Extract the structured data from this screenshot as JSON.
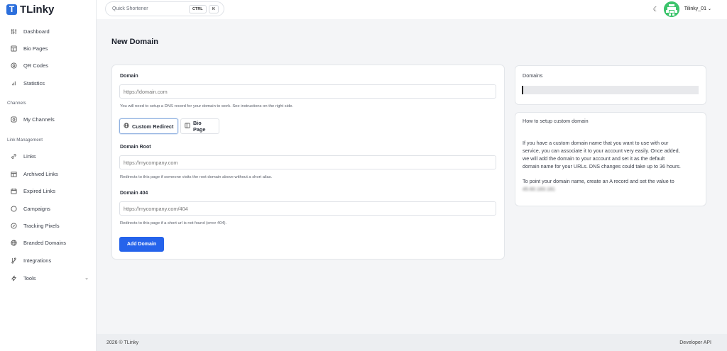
{
  "brand": {
    "name": "TLinky",
    "mark": "T"
  },
  "sidebar": {
    "items": [
      {
        "label": "Dashboard",
        "icon": "sliders-icon"
      },
      {
        "label": "Bio Pages",
        "icon": "layout-icon"
      },
      {
        "label": "QR Codes",
        "icon": "qr-icon"
      },
      {
        "label": "Statistics",
        "icon": "bar-chart-icon"
      }
    ],
    "channels_section": "Channels",
    "channels_items": [
      {
        "label": "My Channels",
        "icon": "box-icon"
      }
    ],
    "link_section": "Link Management",
    "link_items": [
      {
        "label": "Links",
        "icon": "link-icon"
      },
      {
        "label": "Archived Links",
        "icon": "archive-icon"
      },
      {
        "label": "Expired Links",
        "icon": "calendar-icon"
      },
      {
        "label": "Campaigns",
        "icon": "target-icon"
      },
      {
        "label": "Tracking Pixels",
        "icon": "pixel-icon"
      },
      {
        "label": "Branded Domains",
        "icon": "globe-icon"
      },
      {
        "label": "Integrations",
        "icon": "branch-icon"
      },
      {
        "label": "Tools",
        "icon": "bolt-icon",
        "chevron": "⌄"
      }
    ]
  },
  "topbar": {
    "search_placeholder": "Quick Shortener",
    "kbd_ctrl": "CTRL",
    "kbd_k": "K",
    "theme_icon": "moon-icon",
    "username": "Tilinky_01",
    "user_chevron": "⌄"
  },
  "page": {
    "title": "New Domain"
  },
  "form": {
    "domain_label": "Domain",
    "domain_placeholder": "https://domain.com",
    "domain_help": "You will need to setup a DNS record for your domain to work. See instructions on the right side.",
    "toggle_redirect": "Custom Redirect",
    "toggle_bio": "Bio Page",
    "root_label": "Domain Root",
    "root_placeholder": "https://mycompany.com",
    "root_help": "Redirects to this page if someone visits the root domain above without a short alias.",
    "e404_label": "Domain 404",
    "e404_placeholder": "https://mycompany.com/404",
    "e404_help": "Redirects to this page if a short url is not found (error 404).",
    "submit": "Add Domain"
  },
  "domains_card": {
    "title": "Domains"
  },
  "howto_card": {
    "title": "How to setup custom domain",
    "p1_l1": "If you have a custom domain name that you want to use with our",
    "p1_l2": "service, you can associate it to your account very easily. Once added,",
    "p1_l3": "we will add the domain to your account and set it as the default",
    "p1_l4": "domain name for your URLs. DNS changes could take up to 36 hours.",
    "p2": "To point your domain name, create an A record and set the value to",
    "ip": "45.60.183.181"
  },
  "footer": {
    "copyright": "2026 © TLinky",
    "developer": "Developer API"
  },
  "colors": {
    "accent": "#2563eb",
    "brand": "#2c6fdc",
    "avatar": "#39c46a"
  }
}
